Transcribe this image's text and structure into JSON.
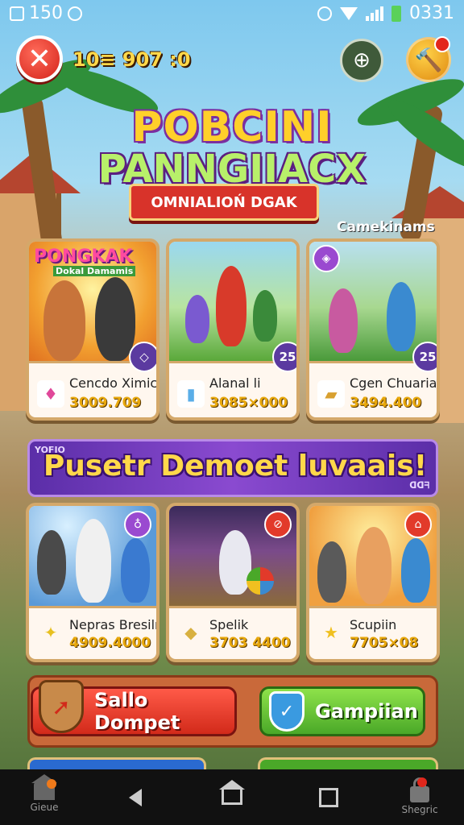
{
  "status_bar": {
    "left_text": "150",
    "right_text": "0331"
  },
  "top_bar": {
    "close_symbol": "✕",
    "score": "10≡ 907 :0",
    "compass_symbol": "⊕",
    "hammer_symbol": "🔨"
  },
  "logo": {
    "line1": "POBCINI",
    "line2": "PANNGIIACX",
    "ribbon": "OMNIALIOŃ DGAK"
  },
  "section": {
    "label": "Camekinams"
  },
  "cards_top": [
    {
      "title": "Cencdo Ximice",
      "price": "3009.709",
      "art_text": "PONGKAK",
      "art_sub": "Dokal Damamis",
      "item_icon": "♦",
      "item_color": "#e0489a"
    },
    {
      "title": "Alanal li",
      "price": "3085×000",
      "badge": "25",
      "item_icon": "▮",
      "item_color": "#5aaee8"
    },
    {
      "title": "Cgen Chuaria",
      "price": "3494.400",
      "badge": "25",
      "item_icon": "▰",
      "item_color": "#d8a030"
    }
  ],
  "promo": {
    "text": "Pusetr Demoet luvaais!",
    "side_left": "YOFIO",
    "side_right": "ᗡᗡᖷ"
  },
  "cards_bottom": [
    {
      "title": "Nepras Bresilny",
      "price": "4909.4000",
      "item_icon": "✦",
      "item_color": "#e8c020"
    },
    {
      "title": "Spelik",
      "price": "3703 4400",
      "item_icon": "◆",
      "item_color": "#f0d070"
    },
    {
      "title": "Scupiin",
      "price": "7705×08",
      "item_icon": "★",
      "item_color": "#f0c020"
    }
  ],
  "actions": {
    "primary": "Sallo Dompet",
    "secondary": "Gampiian"
  },
  "nav": {
    "left_label": "Gieue",
    "right_label": "Shegric"
  }
}
